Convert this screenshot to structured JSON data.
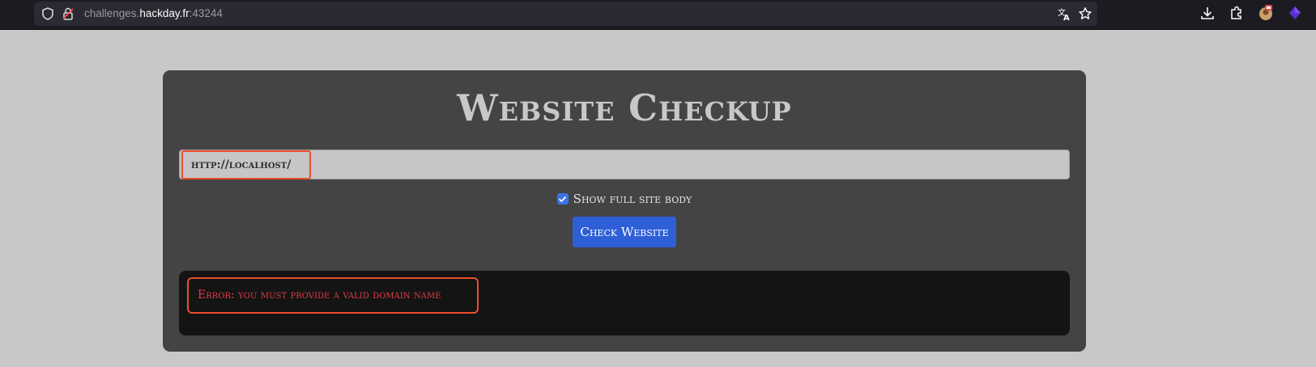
{
  "browser": {
    "url_prefix": "challenges.",
    "url_host": "hackday.fr",
    "url_port": ":43244",
    "icons": [
      "shield-icon",
      "lock-icon",
      "translate-icon",
      "bookmark-star-icon",
      "download-icon",
      "extensions-icon",
      "profile-avatar-icon",
      "extension-diamond-icon"
    ]
  },
  "page": {
    "title": "Website Checkup",
    "url_value": "http://localhost/",
    "checkbox_label": "Show full site body",
    "checkbox_checked": true,
    "button_label": "Check Website",
    "error_message": "Error: you must provide a valid domain name"
  },
  "colors": {
    "page_bg": "#c8c8c8",
    "card_bg": "#444444",
    "button": "#2e5fd6",
    "error_text": "#e23b45",
    "highlight": "#ec4e2e"
  }
}
